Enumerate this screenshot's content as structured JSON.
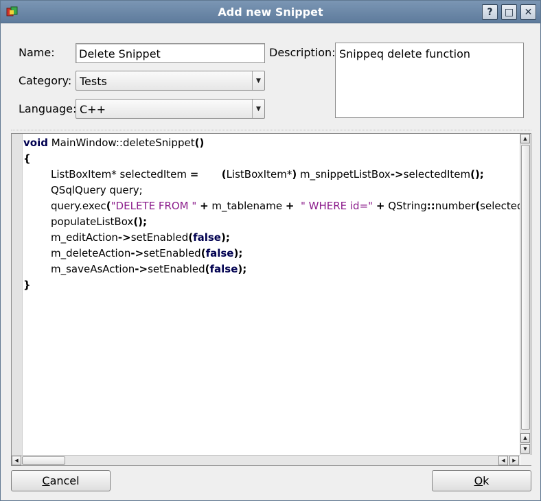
{
  "window": {
    "title": "Add new Snippet",
    "help_label": "?",
    "maximize_label": "□",
    "close_label": "✕"
  },
  "form": {
    "name_label": "Name:",
    "name_value": "Delete Snippet",
    "description_label": "Description:",
    "description_value": "Snippeq delete function",
    "category_label": "Category:",
    "category_value": "Tests",
    "language_label": "Language:",
    "language_value": "C++"
  },
  "editor": {
    "lines": [
      {
        "indent": false,
        "tokens": [
          [
            "kw",
            "void"
          ],
          [
            "t",
            " MainWindow::deleteSnippet"
          ],
          [
            "kb",
            "()"
          ]
        ]
      },
      {
        "indent": false,
        "tokens": [
          [
            "kb",
            "{"
          ]
        ]
      },
      {
        "indent": true,
        "tokens": [
          [
            "t",
            "ListBoxItem* selectedItem "
          ],
          [
            "kb",
            "="
          ],
          [
            "t",
            "       "
          ],
          [
            "kb",
            "("
          ],
          [
            "t",
            "ListBoxItem*"
          ],
          [
            "kb",
            ")"
          ],
          [
            "t",
            " m_snippetListBox"
          ],
          [
            "kb",
            "->"
          ],
          [
            "t",
            "selectedItem"
          ],
          [
            "kb",
            "();"
          ]
        ]
      },
      {
        "indent": true,
        "tokens": [
          [
            "t",
            "QSqlQuery query;"
          ]
        ]
      },
      {
        "indent": true,
        "tokens": [
          [
            "t",
            "query.exec"
          ],
          [
            "kb",
            "("
          ],
          [
            "str",
            "\"DELETE FROM \""
          ],
          [
            "t",
            " "
          ],
          [
            "kb",
            "+"
          ],
          [
            "t",
            " m_tablename "
          ],
          [
            "kb",
            "+"
          ],
          [
            "t",
            "  "
          ],
          [
            "str",
            "\" WHERE id=\""
          ],
          [
            "t",
            " "
          ],
          [
            "kb",
            "+"
          ],
          [
            "t",
            " QString"
          ],
          [
            "kb",
            "::"
          ],
          [
            "t",
            "number"
          ],
          [
            "kb",
            "("
          ],
          [
            "t",
            "selectedItem"
          ]
        ]
      },
      {
        "indent": true,
        "tokens": [
          [
            "t",
            "populateListBox"
          ],
          [
            "kb",
            "();"
          ]
        ]
      },
      {
        "indent": true,
        "tokens": [
          [
            "t",
            "m_editAction"
          ],
          [
            "kb",
            "->"
          ],
          [
            "t",
            "setEnabled"
          ],
          [
            "kb",
            "("
          ],
          [
            "kw",
            "false"
          ],
          [
            "kb",
            ");"
          ]
        ]
      },
      {
        "indent": true,
        "tokens": [
          [
            "t",
            "m_deleteAction"
          ],
          [
            "kb",
            "->"
          ],
          [
            "t",
            "setEnabled"
          ],
          [
            "kb",
            "("
          ],
          [
            "kw",
            "false"
          ],
          [
            "kb",
            ");"
          ]
        ]
      },
      {
        "indent": true,
        "tokens": [
          [
            "t",
            "m_saveAsAction"
          ],
          [
            "kb",
            "->"
          ],
          [
            "t",
            "setEnabled"
          ],
          [
            "kb",
            "("
          ],
          [
            "kw",
            "false"
          ],
          [
            "kb",
            ");"
          ]
        ]
      },
      {
        "indent": false,
        "tokens": [
          [
            "kb",
            "}"
          ]
        ]
      }
    ]
  },
  "buttons": {
    "cancel_mnemonic": "C",
    "cancel_rest": "ancel",
    "ok_mnemonic": "O",
    "ok_rest": "k"
  },
  "icons": {
    "app": "app-icon",
    "combo_arrow": "chevron-down-icon",
    "scroll_up": "arrow-up-icon",
    "scroll_down": "arrow-down-icon",
    "scroll_left": "arrow-left-icon",
    "scroll_right": "arrow-right-icon"
  },
  "colors": {
    "titlebar": "#6a87a8",
    "keyword": "#000050",
    "string": "#8b1c8b"
  }
}
